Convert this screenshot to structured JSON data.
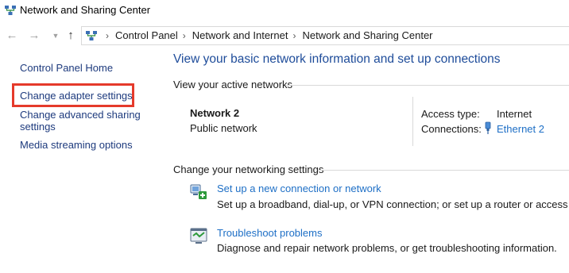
{
  "window": {
    "title": "Network and Sharing Center"
  },
  "address_bar": {
    "breadcrumbs": [
      "Control Panel",
      "Network and Internet",
      "Network and Sharing Center"
    ]
  },
  "left_panel": {
    "links": [
      "Control Panel Home",
      "Change adapter settings",
      "Change advanced sharing",
      "settings",
      "Media streaming options"
    ]
  },
  "main": {
    "heading": "View your basic network information and set up connections",
    "active_networks": {
      "section_title": "View your active networks",
      "network_name": "Network 2",
      "network_type": "Public network",
      "access_type_label": "Access type:",
      "access_type_value": "Internet",
      "connections_label": "Connections:",
      "connections_value": "Ethernet 2"
    },
    "networking_settings": {
      "section_title": "Change your networking settings",
      "tasks": [
        {
          "link": "Set up a new connection or network",
          "description": "Set up a broadband, dial-up, or VPN connection; or set up a router or access point.",
          "icon": "new-connection-icon"
        },
        {
          "link": "Troubleshoot problems",
          "description": "Diagnose and repair network problems, or get troubleshooting information.",
          "icon": "troubleshoot-icon"
        }
      ]
    }
  },
  "colors": {
    "link": "#1e6fc6",
    "heading": "#1e4c9a",
    "left_link": "#1d3a7d",
    "highlight": "#e53a2b"
  }
}
